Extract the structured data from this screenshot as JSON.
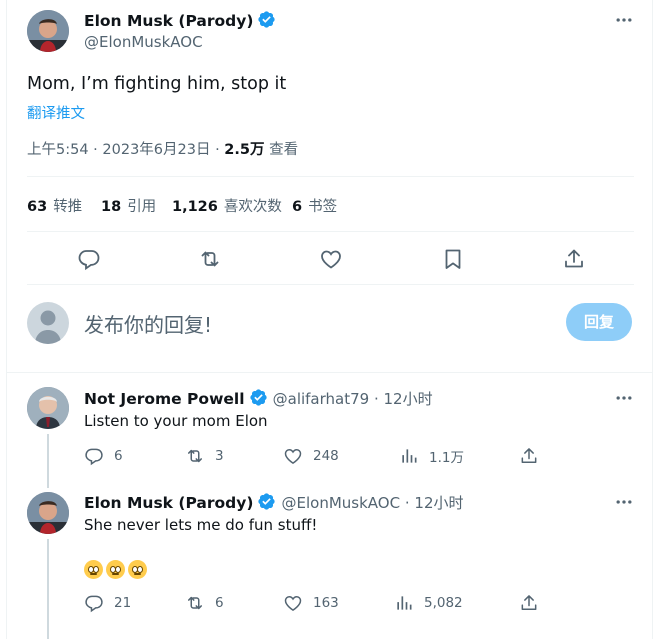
{
  "main_tweet": {
    "author_name": "Elon Musk (Parody)",
    "author_handle": "@ElonMuskAOC",
    "text": "Mom, I’m fighting him, stop it",
    "translate_label": "翻译推文",
    "time": "上午5:54 · 2023年6月23日 · ",
    "views_count": "2.5万",
    "views_label": " 查看"
  },
  "stats": {
    "retweets": {
      "count": "63",
      "label": "转推"
    },
    "quotes": {
      "count": "18",
      "label": "引用"
    },
    "likes": {
      "count": "1,126",
      "label": "喜欢次数"
    },
    "bookmarks": {
      "count": "6",
      "label": "书签"
    }
  },
  "actions": [
    "reply-icon",
    "retweet-icon",
    "like-icon",
    "bookmark-icon",
    "share-icon"
  ],
  "composer": {
    "placeholder": "发布你的回复!",
    "reply_button": "回复"
  },
  "replies": [
    {
      "author_name": "Not Jerome Powell",
      "author_handle": "@alifarhat79",
      "time": " · 12小时",
      "text": "Listen to your mom Elon",
      "reply_count": "6",
      "retweet_count": "3",
      "like_count": "248",
      "view_count": "1.1万"
    },
    {
      "author_name": "Elon Musk (Parody)",
      "author_handle": "@ElonMuskAOC",
      "time": " · 12小时",
      "text": "She never lets me do fun stuff!",
      "emojis": "🙄🙄🙄",
      "reply_count": "21",
      "retweet_count": "6",
      "like_count": "163",
      "view_count": "5,082"
    }
  ],
  "colors": {
    "accent": "#1d9bf0",
    "secondary_text": "#536471",
    "divider": "#eff3f4",
    "reply_button_disabled": "#8ecdf8"
  }
}
